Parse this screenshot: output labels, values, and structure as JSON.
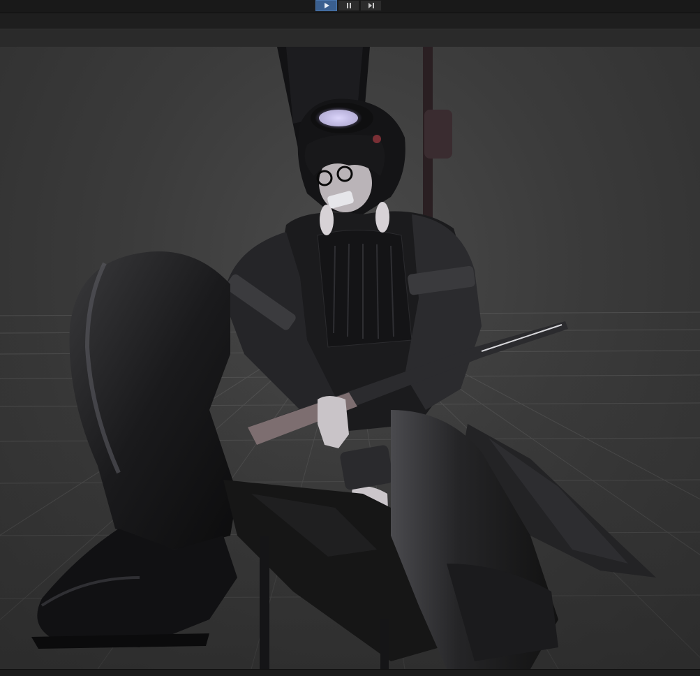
{
  "toolbar": {
    "controls": [
      {
        "icon": "play-icon",
        "state": "active"
      },
      {
        "icon": "pause-icon",
        "state": "inactive"
      },
      {
        "icon": "step-icon",
        "state": "inactive"
      }
    ]
  },
  "viewport": {
    "subject": "character-model",
    "grid": true,
    "background_color": "#3b3b3b",
    "accent_color": "#3a5f8f"
  },
  "status": {
    "text": ""
  }
}
